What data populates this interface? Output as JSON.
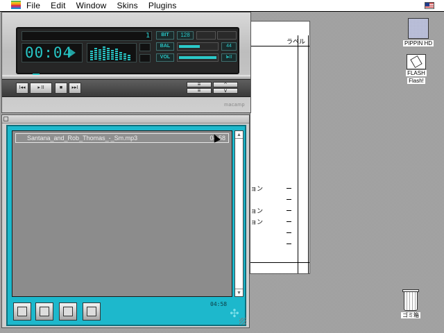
{
  "menubar": {
    "items": [
      "File",
      "Edit",
      "Window",
      "Skins",
      "Plugins"
    ]
  },
  "document_window": {
    "column_header": "ラベル",
    "row_fragments": [
      "ョン",
      "ョン",
      "ョン"
    ]
  },
  "player": {
    "time": "00:04",
    "title_strip": "1",
    "bitrate_label": "BIT",
    "bitrate_value": "128",
    "balance_label": "BAL",
    "balance_end": "44",
    "volume_label": "VOL",
    "volume_end": "I▸II",
    "brand": "macamp",
    "transport": [
      "I◂◂",
      "▸ II",
      "■",
      "▸▸I"
    ],
    "side_buttons": [
      "≡",
      "^",
      "≡",
      "v"
    ]
  },
  "playlist": {
    "tracks": [
      {
        "name": "Santana_and_Rob_Thomas_-_Sm.mp3",
        "duration": "04:58"
      }
    ],
    "total_time": "04:58"
  },
  "desktop": {
    "icons": [
      {
        "label": "PIPPIN HD",
        "type": "hard-disk"
      },
      {
        "label": "FLASH",
        "label2": "Flash!",
        "type": "flash-card"
      },
      {
        "label": "ゴミ箱",
        "type": "trash"
      }
    ]
  },
  "colors": {
    "playlist_accent": "#1db8cc",
    "lcd_text": "#27c6c6"
  }
}
